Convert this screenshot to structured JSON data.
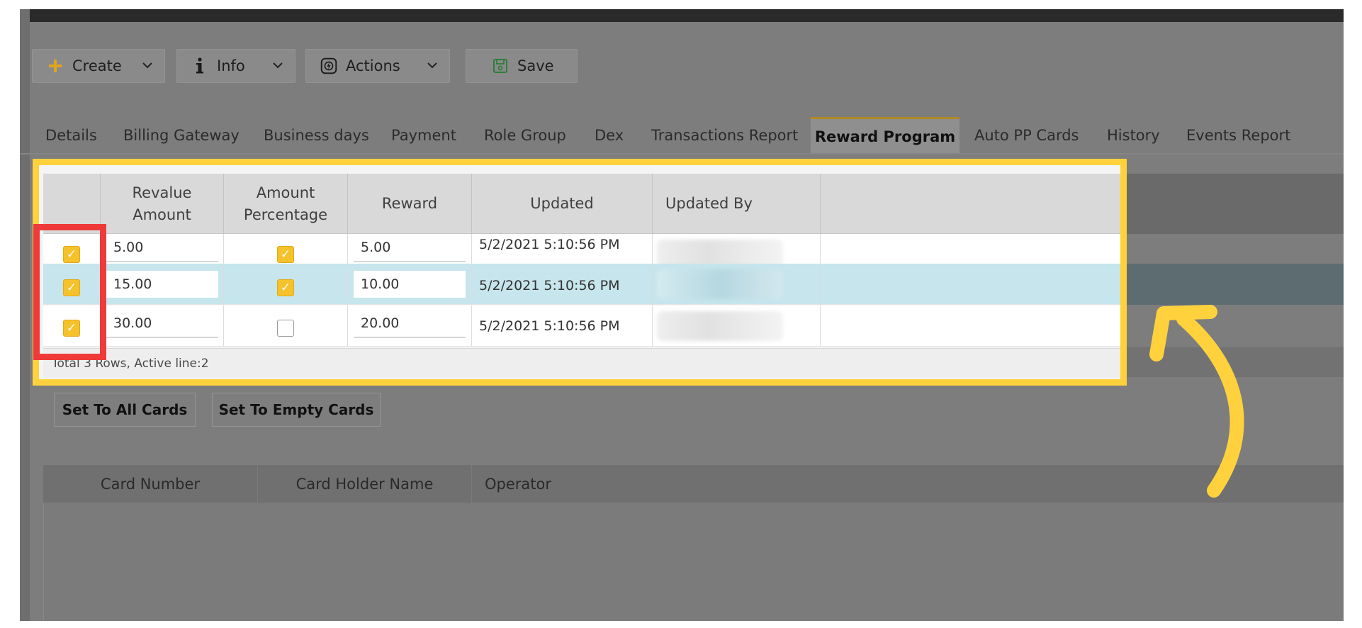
{
  "toolbar": {
    "create": {
      "label": "Create",
      "icon": "plus-icon"
    },
    "info": {
      "label": "Info",
      "icon": "info-icon"
    },
    "actions": {
      "label": "Actions",
      "icon": "actions-icon"
    },
    "save": {
      "label": "Save",
      "icon": "save-icon"
    }
  },
  "tabs": [
    {
      "label": "Details"
    },
    {
      "label": "Billing Gateway"
    },
    {
      "label": "Business days"
    },
    {
      "label": "Payment"
    },
    {
      "label": "Role Group"
    },
    {
      "label": "Dex"
    },
    {
      "label": "Transactions Report"
    },
    {
      "label": "Reward Program",
      "active": true
    },
    {
      "label": "Auto PP Cards"
    },
    {
      "label": "History"
    },
    {
      "label": "Events Report"
    }
  ],
  "reward_grid": {
    "columns": [
      "Revalue Amount",
      "Amount Percentage",
      "Reward",
      "Updated",
      "Updated By"
    ],
    "rows": [
      {
        "selected": true,
        "revalue_amount": "5.00",
        "amount_percentage": true,
        "reward": "5.00",
        "updated": "5/2/2021 5:10:56 PM"
      },
      {
        "selected": true,
        "revalue_amount": "15.00",
        "amount_percentage": true,
        "reward": "10.00",
        "updated": "5/2/2021 5:10:56 PM",
        "active": true
      },
      {
        "selected": true,
        "revalue_amount": "30.00",
        "amount_percentage": false,
        "reward": "20.00",
        "updated": "5/2/2021 5:10:56 PM"
      }
    ],
    "footer": "Total 3 Rows, Active line:2"
  },
  "buttons": {
    "set_all": "Set To All Cards",
    "set_empty": "Set To Empty Cards"
  },
  "cards_grid": {
    "columns": [
      "Card Number",
      "Card Holder Name",
      "Operator"
    ]
  },
  "colors": {
    "highlight": "#ffd23d",
    "selection_box": "#ef3a3a",
    "checkbox": "#f5c22b",
    "active_row": "#c6e5ec"
  }
}
